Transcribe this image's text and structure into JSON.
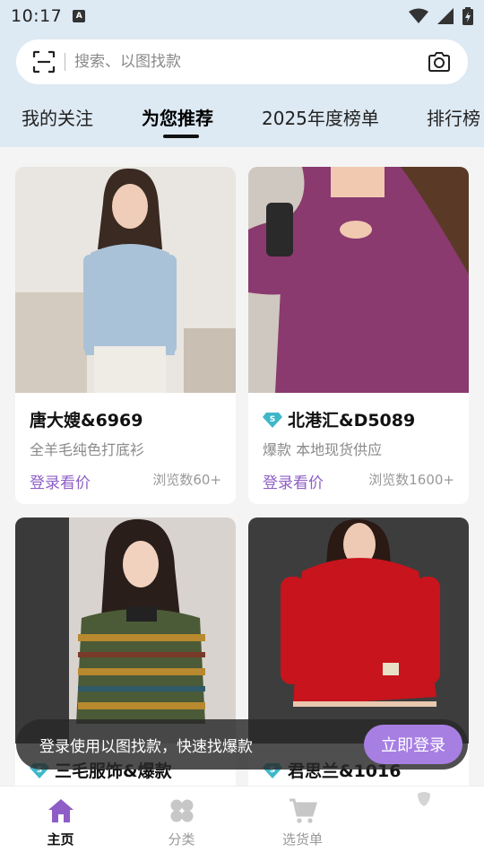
{
  "status": {
    "time": "10:17",
    "app_badge": "A"
  },
  "search": {
    "placeholder": "搜索、以图找款",
    "scan_icon": "scan-icon",
    "camera_icon": "camera-icon"
  },
  "tabs": [
    {
      "label": "我的关注"
    },
    {
      "label": "为您推荐",
      "active": true
    },
    {
      "label": "2025年度榜单"
    },
    {
      "label": "排行榜"
    }
  ],
  "products": [
    {
      "title": "唐大嫂&6969",
      "subtitle": "全羊毛纯色打底衫",
      "price_label": "登录看价",
      "views": "浏览数60+",
      "verified": false,
      "palette": {
        "bg": "#e7e3df",
        "top": "#a9c2d8",
        "hair": "#3a2a22",
        "skin": "#efcdb8"
      }
    },
    {
      "title": "北港汇&D5089",
      "subtitle": "爆款  本地现货供应",
      "price_label": "登录看价",
      "views": "浏览数1600+",
      "verified": true,
      "palette": {
        "bg": "#cfc8c0",
        "top": "#8a3a6e",
        "hair": "#4a2c1c",
        "skin": "#f0c9b0"
      }
    },
    {
      "title": "三毛服饰&爆款",
      "subtitle": "",
      "price_label": "",
      "views": "",
      "verified": true,
      "palette": {
        "bg": "#d9d3cf",
        "top": "#4b5a37",
        "hair": "#2a1e1a",
        "skin": "#f1d2bf"
      }
    },
    {
      "title": "君思兰&1016",
      "subtitle": "",
      "price_label": "",
      "views": "",
      "verified": true,
      "palette": {
        "bg": "#3d3d3d",
        "top": "#c8141c",
        "hair": "#2b1a14",
        "skin": "#eec9b3"
      }
    }
  ],
  "toast": {
    "text": "登录使用以图找款，快速找爆款",
    "button": "立即登录"
  },
  "bottom_nav": [
    {
      "label": "主页",
      "icon": "home-icon",
      "active": true
    },
    {
      "label": "分类",
      "icon": "category-icon"
    },
    {
      "label": "选货单",
      "icon": "cart-icon"
    },
    {
      "label": "",
      "icon": "profile-icon"
    }
  ],
  "colors": {
    "accent": "#8e5ec6",
    "header_bg": "#dde9f3",
    "button": "#a77fe3",
    "diamond": "#3fb7c9"
  }
}
